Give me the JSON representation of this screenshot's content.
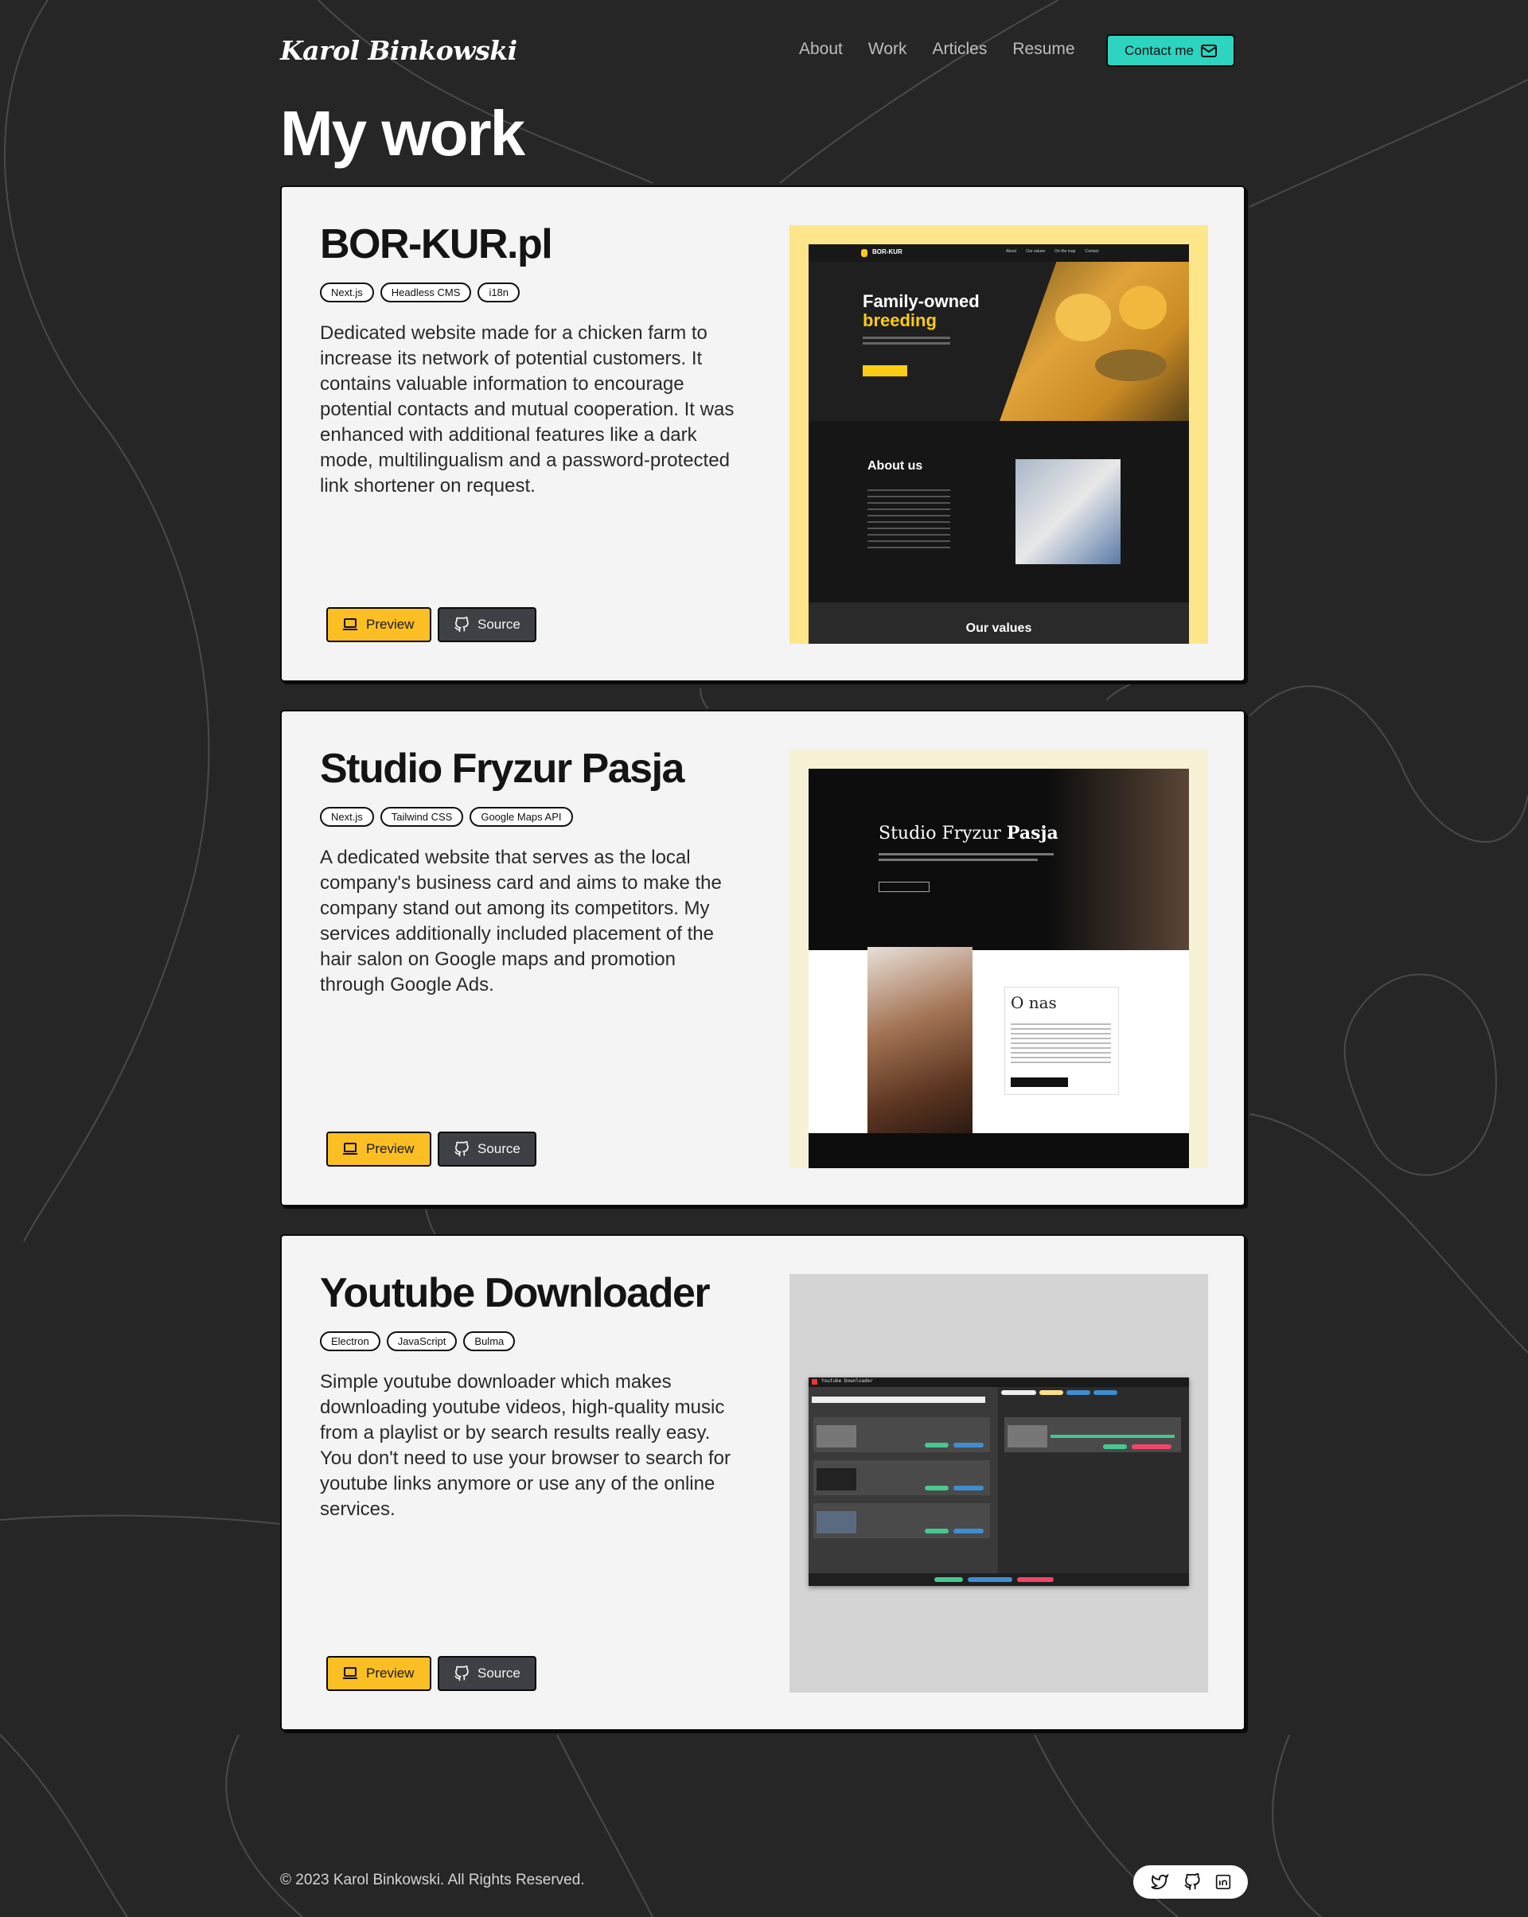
{
  "header": {
    "logo": "Karol Binkowski",
    "nav": [
      "About",
      "Work",
      "Articles",
      "Resume"
    ],
    "contact_label": "Contact me"
  },
  "page_title": "My work",
  "projects": [
    {
      "title": "BOR-KUR.pl",
      "tags": [
        "Next.js",
        "Headless CMS",
        "i18n"
      ],
      "description": "Dedicated website made for a chicken farm to increase its network of potential customers. It contains valuable information to encourage potential contacts and mutual cooperation. It was enhanced with additional features like a dark mode, multilingualism and a password-protected link shortener on request.",
      "preview_label": "Preview",
      "source_label": "Source",
      "screenshot": {
        "brand": "BOR-KUR",
        "nav": [
          "About",
          "Our values",
          "On the map",
          "Contact"
        ],
        "hero_line1": "Family-owned",
        "hero_line2": "breeding",
        "about_title": "About us",
        "values_title": "Our values"
      }
    },
    {
      "title": "Studio Fryzur Pasja",
      "tags": [
        "Next.js",
        "Tailwind CSS",
        "Google Maps API"
      ],
      "description": "A dedicated website that serves as the local company's business card and aims to make the company stand out among its competitors. My services additionally included placement of the hair salon on Google maps and promotion through Google Ads.",
      "preview_label": "Preview",
      "source_label": "Source",
      "screenshot": {
        "hero_title_light": "Studio Fryzur ",
        "hero_title_bold": "Pasja",
        "about_title": "O nas"
      }
    },
    {
      "title": "Youtube Downloader",
      "tags": [
        "Electron",
        "JavaScript",
        "Bulma"
      ],
      "description": "Simple youtube downloader which makes downloading youtube videos, high-quality music from a playlist or by search results really easy. You don't need to use your browser to search for youtube links anymore or use any of the online services.",
      "preview_label": "Preview",
      "source_label": "Source",
      "screenshot": {
        "window_title": "Youtube Downloader"
      }
    }
  ],
  "footer": {
    "copyright": "© 2023 Karol Binkowski. All Rights Reserved.",
    "socials": [
      "twitter-icon",
      "github-icon",
      "linkedin-icon"
    ]
  },
  "colors": {
    "background": "#262626",
    "accent_teal": "#2dd4bf",
    "preview_yellow": "#fbbf24",
    "source_gray": "#3f3f46",
    "card": "#f4f4f4"
  }
}
